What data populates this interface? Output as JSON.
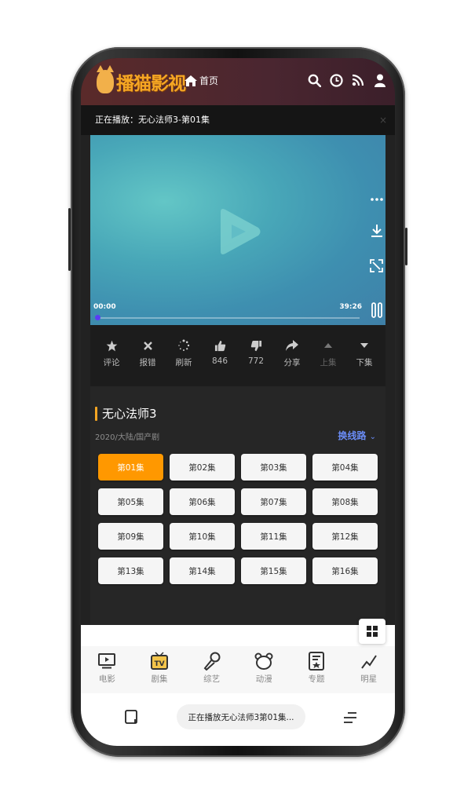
{
  "header": {
    "logo_text": "播猫影视",
    "home_label": "首页",
    "icons": [
      "search-icon",
      "history-icon",
      "rss-icon",
      "user-icon"
    ]
  },
  "now_playing": {
    "text": "正在播放：无心法师3-第01集",
    "close": "×"
  },
  "player": {
    "current_time": "00:00",
    "duration": "39:26",
    "progress": 0,
    "side_icons": [
      "more-icon",
      "download-icon",
      "fullscreen-icon",
      "pause-icon"
    ]
  },
  "actions": [
    {
      "icon": "star-icon",
      "label": "评论"
    },
    {
      "icon": "close-icon",
      "label": "报错"
    },
    {
      "icon": "refresh-icon",
      "label": "刷新"
    },
    {
      "icon": "thumbs-up-icon",
      "label": "846"
    },
    {
      "icon": "thumbs-down-icon",
      "label": "772"
    },
    {
      "icon": "share-icon",
      "label": "分享"
    },
    {
      "icon": "caret-up-icon",
      "label": "上集"
    },
    {
      "icon": "caret-down-icon",
      "label": "下集"
    }
  ],
  "show": {
    "title": "无心法师3",
    "meta": "2020/大陆/国产剧",
    "switch_line": "换线路"
  },
  "episodes": [
    "第01集",
    "第02集",
    "第03集",
    "第04集",
    "第05集",
    "第06集",
    "第07集",
    "第08集",
    "第09集",
    "第10集",
    "第11集",
    "第12集",
    "第13集",
    "第14集",
    "第15集",
    "第16集"
  ],
  "active_episode": "第01集",
  "bottom_nav": [
    {
      "icon": "movie-icon",
      "label": "电影"
    },
    {
      "icon": "tv-icon",
      "label": "剧集"
    },
    {
      "icon": "microphone-icon",
      "label": "综艺"
    },
    {
      "icon": "bear-icon",
      "label": "动漫"
    },
    {
      "icon": "topic-icon",
      "label": "专题"
    },
    {
      "icon": "star-trend-icon",
      "label": "明星"
    }
  ],
  "browser": {
    "pill_text": "正在播放无心法师3第01集..."
  },
  "colors": {
    "accent_orange": "#ff9800",
    "link_blue": "#6a8cf5",
    "progress_dot": "#5b3cf5"
  }
}
